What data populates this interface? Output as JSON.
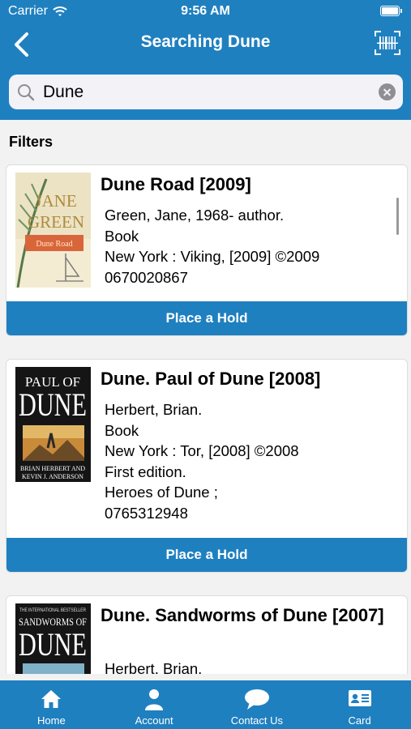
{
  "status_bar": {
    "carrier": "Carrier",
    "time": "9:56 AM"
  },
  "nav": {
    "title": "Searching Dune",
    "back_icon": "chevron-left-icon",
    "scan_icon": "barcode-scan-icon"
  },
  "search": {
    "value": "Dune"
  },
  "filters_label": "Filters",
  "results": [
    {
      "title": "Dune Road [2009]",
      "lines": [
        "Green, Jane, 1968- author.",
        "Book",
        "New York : Viking, [2009] ©2009",
        "0670020867"
      ],
      "hold_label": "Place a Hold",
      "cover": {
        "line1": "JANE",
        "line2": "GREEN",
        "subtitle": "Dune Road"
      }
    },
    {
      "title": "Dune. Paul of Dune [2008]",
      "lines": [
        "Herbert, Brian.",
        "Book",
        "New York : Tor, [2008] ©2008",
        "First edition.",
        "Heroes of Dune ;",
        "0765312948"
      ],
      "hold_label": "Place a Hold",
      "cover": {
        "line1": "PAUL OF",
        "line2": "DUNE",
        "authors1": "BRIAN HERBERT AND",
        "authors2": "KEVIN J. ANDERSON"
      }
    },
    {
      "title": "Dune. Sandworms of Dune [2007]",
      "lines": [
        "Herbert, Brian."
      ],
      "cover": {
        "tagline": "THE INTERNATIONAL BESTSELLER",
        "line1": "SANDWORMS OF",
        "line2": "DUNE"
      }
    }
  ],
  "tabs": [
    {
      "label": "Home",
      "icon": "home-icon"
    },
    {
      "label": "Account",
      "icon": "person-icon"
    },
    {
      "label": "Contact Us",
      "icon": "chat-bubble-icon"
    },
    {
      "label": "Card",
      "icon": "id-card-icon"
    }
  ],
  "colors": {
    "primary": "#1f80c0",
    "background": "#f2f2f2"
  }
}
